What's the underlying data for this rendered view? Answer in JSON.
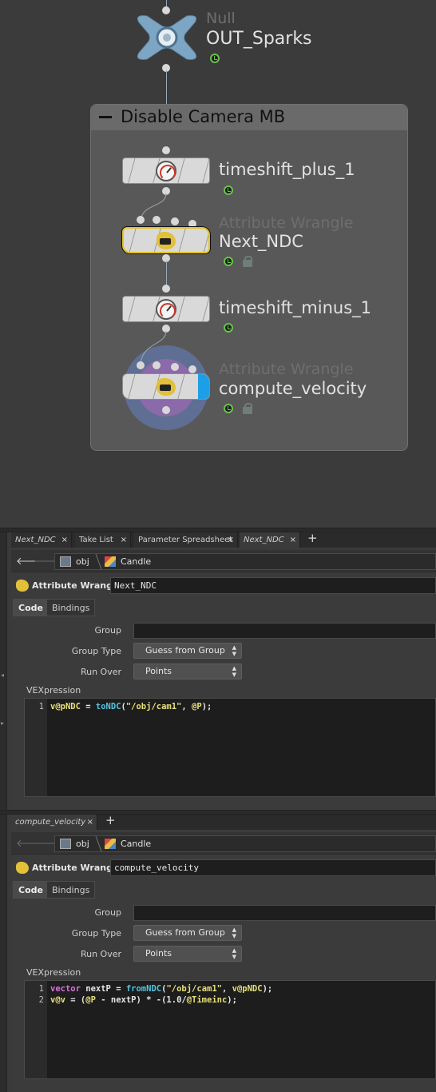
{
  "network": {
    "null_node": {
      "type": "Null",
      "name": "OUT_Sparks"
    },
    "netbox": {
      "title": "Disable Camera MB"
    },
    "nodes": [
      {
        "name": "timeshift_plus_1",
        "type": ""
      },
      {
        "name": "Next_NDC",
        "type": "Attribute Wrangle"
      },
      {
        "name": "timeshift_minus_1",
        "type": ""
      },
      {
        "name": "compute_velocity",
        "type": "Attribute Wrangle"
      }
    ]
  },
  "pane1": {
    "tabs": [
      {
        "label": "Next_NDC",
        "italic": true
      },
      {
        "label": "Take List",
        "italic": false
      },
      {
        "label": "Parameter Spreadsheet",
        "italic": false
      },
      {
        "label": "Next_NDC",
        "italic": true
      }
    ],
    "add_tab": "+",
    "close": "×",
    "path": {
      "root": "obj",
      "node": "Candle"
    },
    "op_type": "Attribute Wrangle",
    "op_name": "Next_NDC",
    "subtabs": [
      "Code",
      "Bindings"
    ],
    "parms": {
      "group_label": "Group",
      "group_value": "",
      "group_type_label": "Group Type",
      "group_type_value": "Guess from Group",
      "run_over_label": "Run Over",
      "run_over_value": "Points"
    },
    "vex_label": "VEXpression",
    "code": [
      {
        "n": "1",
        "parts": [
          [
            "attr",
            "v@pNDC"
          ],
          [
            "plain",
            " = "
          ],
          [
            "fn",
            "toNDC"
          ],
          [
            "plain",
            "("
          ],
          [
            "str",
            "\"/obj/cam1\""
          ],
          [
            "plain",
            ", "
          ],
          [
            "attr",
            "@P"
          ],
          [
            "plain",
            ");"
          ]
        ]
      }
    ]
  },
  "pane2": {
    "tabs": [
      {
        "label": "compute_velocity",
        "italic": true
      }
    ],
    "add_tab": "+",
    "close": "×",
    "path": {
      "root": "obj",
      "node": "Candle"
    },
    "op_type": "Attribute Wrangle",
    "op_name": "compute_velocity",
    "subtabs": [
      "Code",
      "Bindings"
    ],
    "parms": {
      "group_label": "Group",
      "group_value": "",
      "group_type_label": "Group Type",
      "group_type_value": "Guess from Group",
      "run_over_label": "Run Over",
      "run_over_value": "Points"
    },
    "vex_label": "VEXpression",
    "code": [
      {
        "n": "1",
        "parts": [
          [
            "kw",
            "vector"
          ],
          [
            "plain",
            " nextP = "
          ],
          [
            "fn",
            "fromNDC"
          ],
          [
            "plain",
            "("
          ],
          [
            "str",
            "\"/obj/cam1\""
          ],
          [
            "plain",
            ", "
          ],
          [
            "attr",
            "v@pNDC"
          ],
          [
            "plain",
            ");"
          ]
        ]
      },
      {
        "n": "2",
        "parts": [
          [
            "attr",
            "v@v"
          ],
          [
            "plain",
            " = ("
          ],
          [
            "attr",
            "@P"
          ],
          [
            "plain",
            " - nextP) * -(1.0/"
          ],
          [
            "attr",
            "@Timeinc"
          ],
          [
            "plain",
            ");"
          ]
        ]
      }
    ]
  },
  "colors": {
    "selected_outline": "#e5c21f",
    "flag_green": "#67c24c",
    "wire": "#9aa9b8"
  }
}
